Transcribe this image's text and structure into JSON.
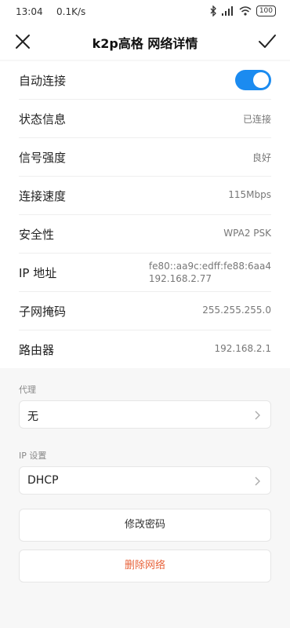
{
  "status_bar": {
    "time": "13:04",
    "net_speed": "0.1K/s",
    "icons": [
      "bluetooth-icon",
      "signal-icon",
      "wifi-icon",
      "battery-icon"
    ],
    "battery": "100"
  },
  "header": {
    "title": "k2p高格  网络详情",
    "close_icon": "close-icon",
    "confirm_icon": "check-icon"
  },
  "details": {
    "auto_connect": {
      "label": "自动连接",
      "enabled": true
    },
    "status": {
      "label": "状态信息",
      "value": "已连接"
    },
    "signal": {
      "label": "信号强度",
      "value": "良好"
    },
    "speed": {
      "label": "连接速度",
      "value": "115Mbps"
    },
    "security": {
      "label": "安全性",
      "value": "WPA2 PSK"
    },
    "ip": {
      "label": "IP 地址",
      "value_line1": "fe80::aa9c:edff:fe88:6aa4",
      "value_line2": "192.168.2.77"
    },
    "subnet": {
      "label": "子网掩码",
      "value": "255.255.255.0"
    },
    "router": {
      "label": "路由器",
      "value": "192.168.2.1"
    }
  },
  "proxy": {
    "label": "代理",
    "value": "无"
  },
  "ip_settings": {
    "label": "IP 设置",
    "value": "DHCP"
  },
  "actions": {
    "change_password": "修改密码",
    "delete_network": "删除网络"
  },
  "colors": {
    "accent": "#1b8bf0",
    "danger": "#e8643c"
  }
}
